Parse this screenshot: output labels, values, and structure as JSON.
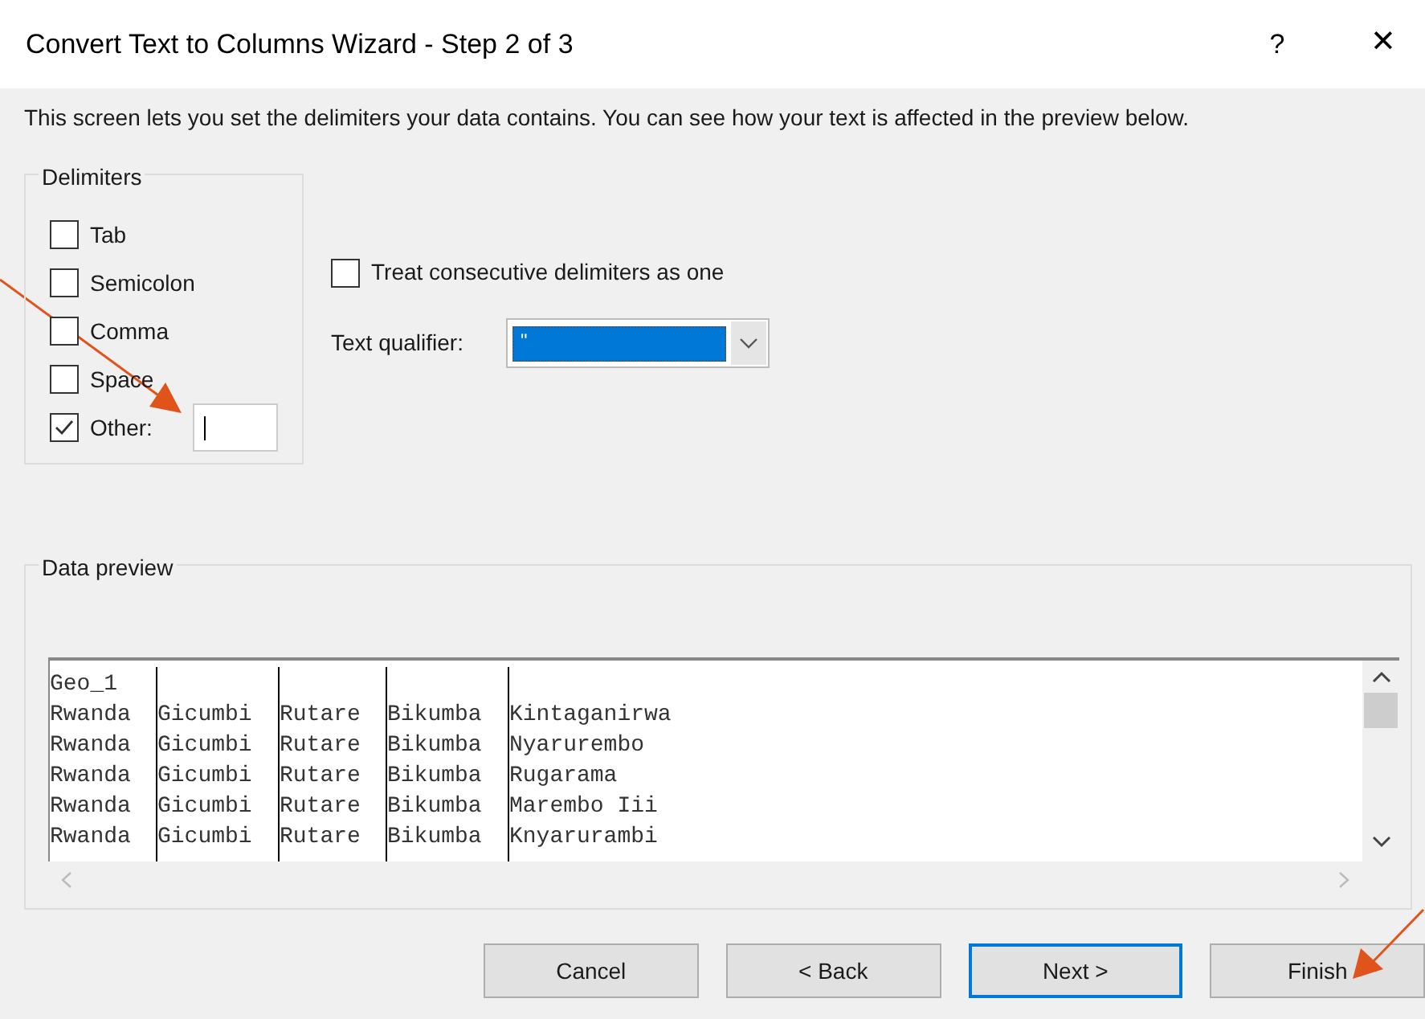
{
  "window": {
    "title": "Convert Text to Columns Wizard - Step 2 of 3",
    "help": "?",
    "close": "✕"
  },
  "description": "This screen lets you set the delimiters your data contains.  You can see how your text is affected in the preview below.",
  "delimiters": {
    "title": "Delimiters",
    "items": [
      {
        "label": "Tab",
        "checked": false
      },
      {
        "label": "Semicolon",
        "checked": false
      },
      {
        "label": "Comma",
        "checked": false
      },
      {
        "label": "Space",
        "checked": false
      },
      {
        "label": "Other:",
        "checked": true,
        "kind": "other"
      }
    ]
  },
  "consecutive": {
    "label": "Treat consecutive delimiters as one",
    "checked": false
  },
  "text_qualifier": {
    "label": "Text qualifier:",
    "value": "\""
  },
  "preview": {
    "title": "Data preview",
    "rows": [
      [
        "Geo_1"
      ],
      [
        "Rwanda",
        "Gicumbi",
        "Rutare",
        "Bikumba",
        "Kintaganirwa"
      ],
      [
        "Rwanda",
        "Gicumbi",
        "Rutare",
        "Bikumba",
        "Nyarurembo"
      ],
      [
        "Rwanda",
        "Gicumbi",
        "Rutare",
        "Bikumba",
        "Rugarama"
      ],
      [
        "Rwanda",
        "Gicumbi",
        "Rutare",
        "Bikumba",
        "Marembo Iii"
      ],
      [
        "Rwanda",
        "Gicumbi",
        "Rutare",
        "Bikumba",
        "Knyarurambi"
      ]
    ]
  },
  "buttons": [
    {
      "label": "Cancel",
      "default": false
    },
    {
      "label": "< Back",
      "default": false
    },
    {
      "label": "Next >",
      "default": true
    },
    {
      "label": "Finish",
      "default": false
    }
  ]
}
